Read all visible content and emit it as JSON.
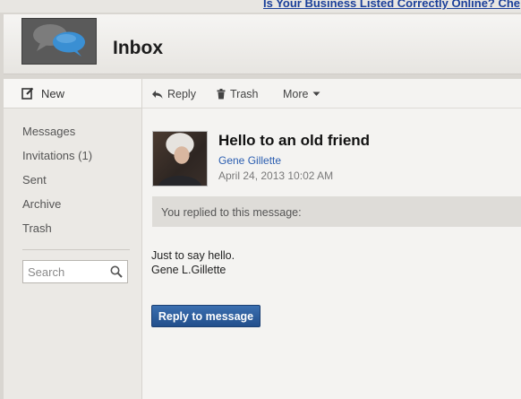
{
  "ad": {
    "text": "Is Your Business Listed Correctly Online? Che"
  },
  "header": {
    "title": "Inbox",
    "logo_icon": "speech-bubbles-icon"
  },
  "sidebar": {
    "new_label": "New",
    "items": [
      {
        "label": "Messages"
      },
      {
        "label": "Invitations (1)"
      },
      {
        "label": "Sent"
      },
      {
        "label": "Archive"
      },
      {
        "label": "Trash"
      }
    ],
    "search": {
      "placeholder": "Search",
      "value": ""
    }
  },
  "toolbar": {
    "reply_label": "Reply",
    "trash_label": "Trash",
    "more_label": "More"
  },
  "message": {
    "subject": "Hello to an old friend",
    "sender": "Gene Gillette",
    "date": "April 24, 2013 10:02 AM",
    "replied_notice": "You replied to this message:",
    "body_lines": [
      "Just to say hello.",
      "Gene L.Gillette"
    ],
    "reply_button": "Reply to message"
  },
  "colors": {
    "accent": "#2a5db0",
    "button": "#224f8c",
    "ad_link": "#1a3f9a"
  }
}
